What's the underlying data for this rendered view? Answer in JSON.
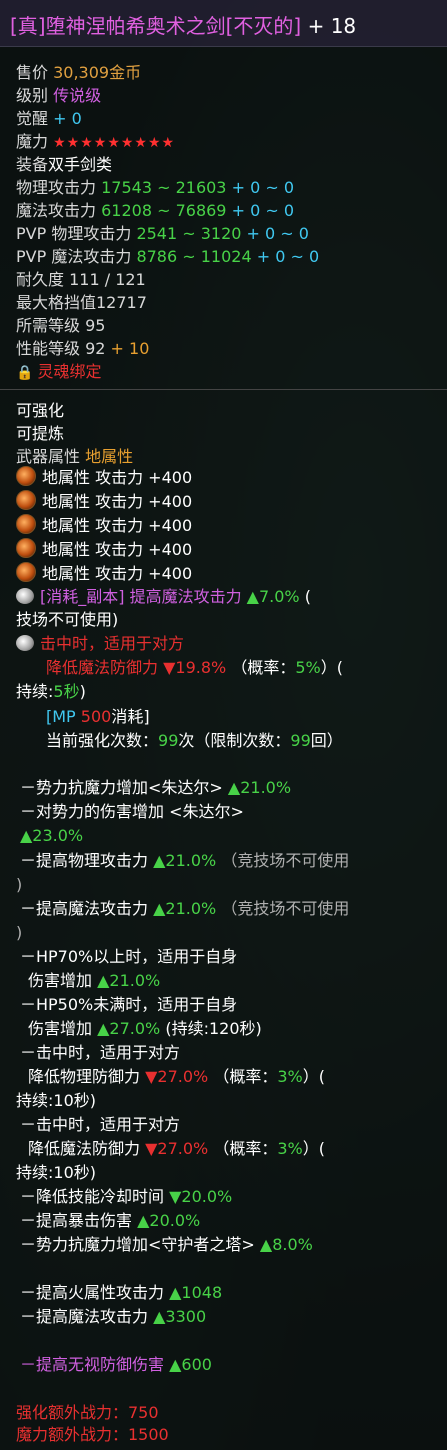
{
  "title": {
    "name": "[真]堕神涅帕希奥术之剑[不灭的]",
    "plus": "+ 18"
  },
  "basic": {
    "price_label": "售价",
    "price_value": "30,309金币",
    "grade_label": "级别",
    "grade_value": "传说级",
    "awaken_label": "觉醒",
    "awaken_value": "+ 0",
    "magic_label": "魔力",
    "magic_stars": "★★★★★★★★★",
    "equip_label": "装备",
    "equip_value": "双手剑类",
    "phys_label": "物理攻击力",
    "phys_range": "17543 ~ 21603",
    "phys_bonus": "+ 0 ~ 0",
    "mag_label": "魔法攻击力",
    "mag_range": "61208 ~ 76869",
    "mag_bonus": "+ 0 ~ 0",
    "pvp_phys_label": "PVP 物理攻击力",
    "pvp_phys_range": "2541 ~ 3120",
    "pvp_phys_bonus": "+ 0 ~ 0",
    "pvp_mag_label": "PVP 魔法攻击力",
    "pvp_mag_range": "8786 ~ 11024",
    "pvp_mag_bonus": "+ 0 ~ 0",
    "durability": "耐久度 111 / 121",
    "block": "最大格挡值12717",
    "req_level": "所需等级 95",
    "perf_label": "性能等级 92",
    "perf_bonus": "+ 10",
    "soulbound": "灵魂绑定"
  },
  "enhance": {
    "can_enhance": "可强化",
    "can_refine": "可提炼",
    "weapon_attr_label": "武器属性",
    "weapon_attr_value": "地属性",
    "gems": [
      "地属性 攻击力 +400",
      "地属性 攻击力 +400",
      "地属性 攻击力 +400",
      "地属性 攻击力 +400",
      "地属性 攻击力 +400"
    ],
    "skill1_a": "[消耗_副本] 提高魔法攻击力",
    "skill1_b": "▲7.0%",
    "skill1_c": "(",
    "skill1_d": "技场不可使用)",
    "skill2_a": "击中时，适用于对方",
    "skill2_b": "降低魔法防御力",
    "skill2_c": "▼19.8%",
    "skill2_d": "（概率：",
    "skill2_e": "5%",
    "skill2_f": "）(",
    "skill2_g": "持续:",
    "skill2_h": "5秒",
    "skill2_i": ")",
    "mp_a": "[MP",
    "mp_b": "500",
    "mp_c": "消耗]",
    "count_a": "当前强化次数：",
    "count_b": "99",
    "count_c": "次（限制次数：",
    "count_d": "99",
    "count_e": "回）"
  },
  "attrs": {
    "l1a": "－势力抗魔力增加<朱达尔>",
    "l1b": "▲21.0%",
    "l2a": "－对势力的伤害增加 <朱达尔>",
    "l2b": "▲23.0%",
    "l3a": "－提高物理攻击力",
    "l3b": "▲21.0%",
    "l3c": "（竞技场不可使用",
    "l3d": ")",
    "l4a": "－提高魔法攻击力",
    "l4b": "▲21.0%",
    "l4c": "（竞技场不可使用",
    "l4d": ")",
    "l5a": "－HP70%以上时，适用于自身",
    "l5b": "伤害增加",
    "l5c": "▲21.0%",
    "l6a": "－HP50%未满时，适用于自身",
    "l6b": "伤害增加",
    "l6c": "▲27.0%",
    "l6d": "(持续:120秒)",
    "l7a": "－击中时，适用于对方",
    "l7b": "降低物理防御力",
    "l7c": "▼27.0%",
    "l7d": "（概率：",
    "l7e": "3%",
    "l7f": "）(",
    "l7g": "持续:10秒)",
    "l8a": "－击中时，适用于对方",
    "l8b": "降低魔法防御力",
    "l8c": "▼27.0%",
    "l8d": "（概率：",
    "l8e": "3%",
    "l8f": "）(",
    "l8g": "持续:10秒)",
    "l9a": "－降低技能冷却时间",
    "l9b": "▼20.0%",
    "l10a": "－提高暴击伤害",
    "l10b": "▲20.0%",
    "l11a": "－势力抗魔力增加<守护者之塔>",
    "l11b": "▲8.0%",
    "l12a": "－提高火属性攻击力",
    "l12b": "▲1048",
    "l13a": "－提高魔法攻击力",
    "l13b": "▲3300",
    "l14a": "－提高无视防御伤害",
    "l14b": "▲600"
  },
  "footer": {
    "enh_power": "强化额外战力：750",
    "mag_power": "魔力额外战力：1500"
  }
}
